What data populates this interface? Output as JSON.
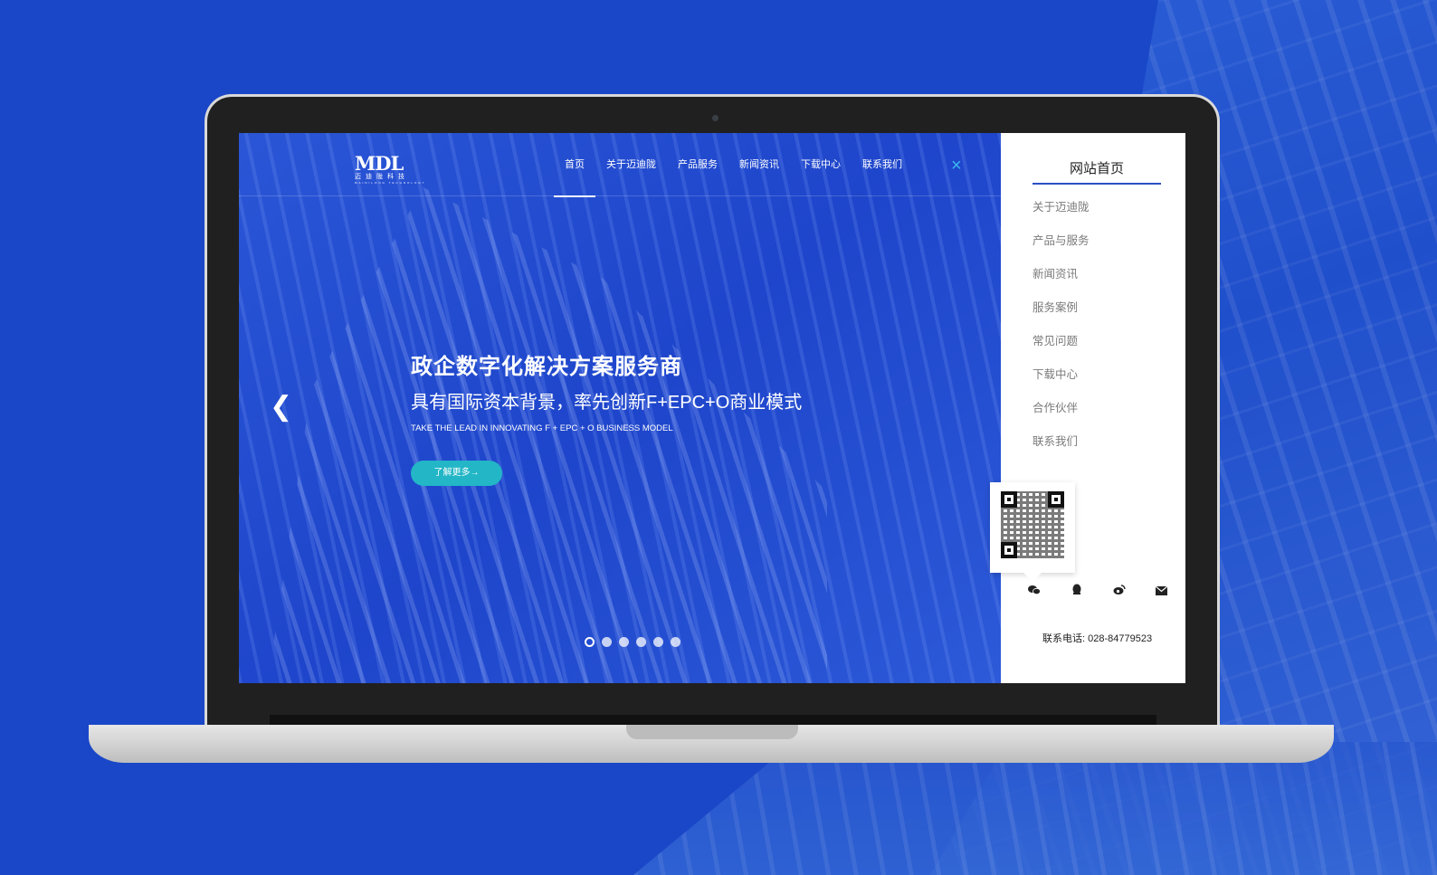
{
  "nav": {
    "logo_main": "MDL",
    "logo_sub": "迈迪陇科技",
    "logo_sub2": "MAIDILONG TECHNOLOGY",
    "items": [
      {
        "label": "首页",
        "active": true
      },
      {
        "label": "关于迈迪陇",
        "active": false
      },
      {
        "label": "产品服务",
        "active": false
      },
      {
        "label": "新闻资讯",
        "active": false
      },
      {
        "label": "下载中心",
        "active": false
      },
      {
        "label": "联系我们",
        "active": false
      }
    ],
    "close_icon": "×"
  },
  "hero": {
    "title": "政企数字化解决方案服务商",
    "subtitle": "具有国际资本背景，率先创新F+EPC+O商业模式",
    "tagline": "TAKE THE LEAD IN INNOVATING F + EPC + O BUSINESS MODEL",
    "button": "了解更多→",
    "prev_icon": "❮",
    "dots_total": 6,
    "dots_active": 1
  },
  "side_menu": {
    "title": "网站首页",
    "items": [
      "关于迈迪陇",
      "产品与服务",
      "新闻资讯",
      "服务案例",
      "常见问题",
      "下载中心",
      "合作伙伴",
      "联系我们"
    ],
    "social_icons": [
      "wechat-icon",
      "qq-icon",
      "weibo-icon",
      "mail-icon"
    ],
    "phone": "联系电话: 028-84779523"
  },
  "colors": {
    "background": "#1a47c8",
    "accent": "#2a4fc5",
    "button": "#22b6c6",
    "close": "#3ab8ef"
  }
}
